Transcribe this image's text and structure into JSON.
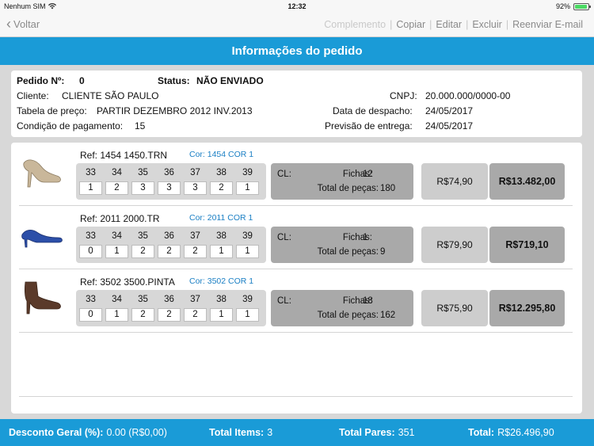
{
  "status_bar": {
    "carrier": "Nenhum SIM",
    "time": "12:32",
    "battery": "92%",
    "battery_level": 0.92
  },
  "nav": {
    "back_label": "Voltar",
    "actions": [
      "Complemento",
      "Copiar",
      "Editar",
      "Excluir",
      "Reenviar E-mail"
    ]
  },
  "title": "Informações do pedido",
  "order": {
    "pedido_label": "Pedido Nº:",
    "pedido_value": "0",
    "status_label": "Status:",
    "status_value": "NÃO ENVIADO",
    "cliente_label": "Cliente:",
    "cliente_value": "CLIENTE SÃO PAULO",
    "cnpj_label": "CNPJ:",
    "cnpj_value": "20.000.000/0000-00",
    "tabela_label": "Tabela de preço:",
    "tabela_value": "PARTIR DEZEMBRO 2012 INV.2013",
    "despacho_label": "Data de despacho:",
    "despacho_value": "24/05/2017",
    "condicao_label": "Condição de pagamento:",
    "condicao_value": "15",
    "previsao_label": "Previsão de entrega:",
    "previsao_value": "24/05/2017"
  },
  "items_labels": {
    "cl": "CL:",
    "fichas": "Fichas:",
    "total_pecas": "Total de peças:"
  },
  "items": [
    {
      "ref": "Ref: 1454 1450.TRN",
      "cor": "Cor: 1454 COR 1",
      "sizes": [
        "33",
        "34",
        "35",
        "36",
        "37",
        "38",
        "39"
      ],
      "qtys": [
        "1",
        "2",
        "3",
        "3",
        "3",
        "2",
        "1"
      ],
      "fichas": "12",
      "total_pecas": "180",
      "price": "R$74,90",
      "total": "R$13.482,00",
      "shoe_color": "#c9b79a"
    },
    {
      "ref": "Ref: 2011 2000.TR",
      "cor": "Cor: 2011 COR 1",
      "sizes": [
        "33",
        "34",
        "35",
        "36",
        "37",
        "38",
        "39"
      ],
      "qtys": [
        "0",
        "1",
        "2",
        "2",
        "2",
        "1",
        "1"
      ],
      "fichas": "1",
      "total_pecas": "9",
      "price": "R$79,90",
      "total": "R$719,10",
      "shoe_color": "#2c4fa8"
    },
    {
      "ref": "Ref: 3502 3500.PINTA",
      "cor": "Cor: 3502 COR 1",
      "sizes": [
        "33",
        "34",
        "35",
        "36",
        "37",
        "38",
        "39"
      ],
      "qtys": [
        "0",
        "1",
        "2",
        "2",
        "2",
        "1",
        "1"
      ],
      "fichas": "18",
      "total_pecas": "162",
      "price": "R$75,90",
      "total": "R$12.295,80",
      "shoe_color": "#5a3a2a"
    }
  ],
  "footer": {
    "desconto_label": "Desconto Geral (%):",
    "desconto_value": "0.00 (R$0,00)",
    "items_label": "Total Items:",
    "items_value": "3",
    "pares_label": "Total Pares:",
    "pares_value": "351",
    "total_label": "Total:",
    "total_value": "R$26.496,90"
  },
  "colors": {
    "accent": "#1a9bd7",
    "link": "#1a7fc4",
    "panel_dark": "#a9a9a9"
  }
}
